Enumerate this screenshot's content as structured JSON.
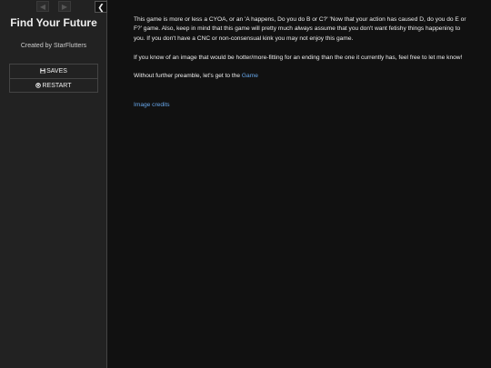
{
  "sidebar": {
    "back_icon": "arrow-left-icon",
    "forward_icon": "arrow-right-icon",
    "toggle_icon": "chevron-left-icon",
    "title": "Find Your Future",
    "author": "Created by StarFlutters",
    "menu": {
      "saves_label": "SAVES",
      "saves_icon": "save-icon",
      "restart_label": "RESTART",
      "restart_icon": "power-icon"
    }
  },
  "passage": {
    "para1_a": "This game is more or less a CYOA, or an 'A happens, Do you do B or C?' 'Now that your action has caused D, do you do E or F?' game. Also, keep in mind that this game will pretty much ",
    "para1_em": "always",
    "para1_b": " assume that you don't want fetishy things happening to you. If you don't have a CNC or non-consensual kink you may not enjoy this game.",
    "para2": "If you know of an image that would be hotter/more-fitting for an ending than the one it currently has, feel free to let me know!",
    "para3_text": "Without further preamble, let's get to the ",
    "para3_link": "Game",
    "credits_link": "Image credits"
  },
  "colors": {
    "background": "#111111",
    "sidebar": "#222222",
    "link": "#68a8ec",
    "text": "#eeeeee"
  }
}
